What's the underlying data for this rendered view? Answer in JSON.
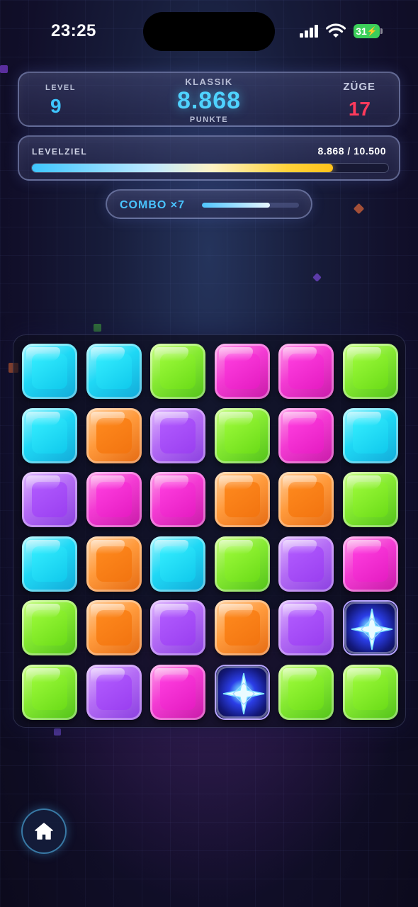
{
  "status_bar": {
    "time": "23:25",
    "battery": "31"
  },
  "header": {
    "level_label": "LEVEL",
    "level_value": "9",
    "mode_label": "KLASSIK",
    "score_value": "8.868",
    "score_unit": "PUNKTE",
    "moves_label": "ZÜGE",
    "moves_value": "17"
  },
  "goal": {
    "label": "LEVELZIEL",
    "value_text": "8.868 / 10.500",
    "progress_fraction": 0.845
  },
  "combo": {
    "label": "COMBO ×7",
    "progress_fraction": 0.7
  },
  "board": {
    "rows": 6,
    "cols": 6,
    "tiles": [
      [
        "cyan",
        "cyan",
        "green",
        "pink",
        "pink",
        "green"
      ],
      [
        "cyan",
        "orange",
        "purple",
        "green",
        "pink",
        "cyan"
      ],
      [
        "purple",
        "pink",
        "pink",
        "orange",
        "orange",
        "green"
      ],
      [
        "cyan",
        "orange",
        "cyan",
        "green",
        "purple",
        "pink"
      ],
      [
        "green",
        "orange",
        "purple",
        "orange",
        "purple",
        "special"
      ],
      [
        "green",
        "purple",
        "pink",
        "special",
        "green",
        "green"
      ]
    ]
  },
  "colors": {
    "accent_blue": "#4fd2ff",
    "moves_red": "#ff3a5c",
    "goal_gold": "#ffd23a"
  },
  "icons": {
    "home": "home-icon",
    "signal": "cellular-signal-icon",
    "wifi": "wifi-icon",
    "battery": "battery-charging-icon",
    "special_tile": "star-burst-icon"
  }
}
